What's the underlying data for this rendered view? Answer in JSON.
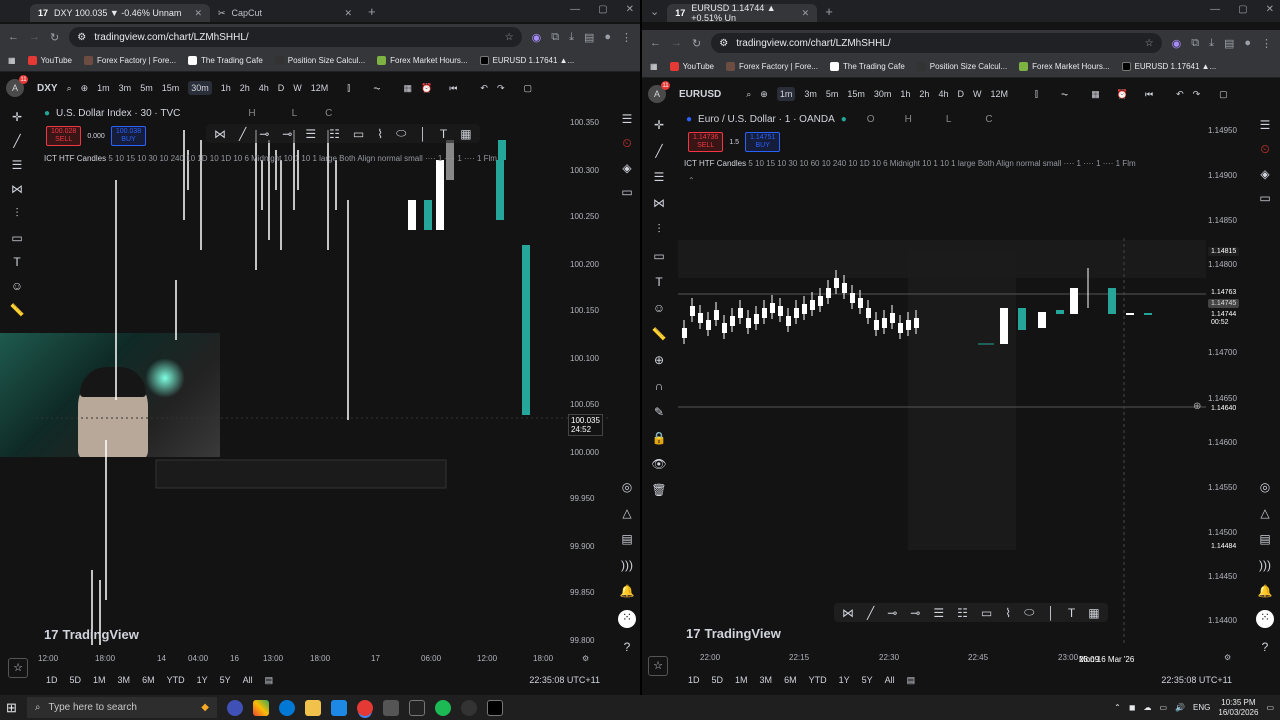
{
  "left": {
    "tabs": [
      {
        "label": "DXY 100.035 ▼ -0.46% Unnam",
        "active": true
      },
      {
        "label": "CapCut",
        "active": false
      }
    ],
    "url": "tradingview.com/chart/LZMhSHHL/",
    "bookmarks": [
      "YouTube",
      "Forex Factory | Fore...",
      "The Trading Cafe",
      "Position Size Calcul...",
      "Forex Market Hours...",
      "EURUSD 1.17641 ▲..."
    ],
    "symbol": "DXY",
    "timeframes": [
      "1m",
      "3m",
      "5m",
      "15m",
      "30m",
      "1h",
      "2h",
      "4h",
      "D",
      "W",
      "12M"
    ],
    "active_tf": "30m",
    "badge_count": "11",
    "title": "U.S. Dollar Index · 30 · TVC",
    "ohlc_h": "H",
    "ohlc_l": "L",
    "ohlc_c": "C",
    "sell_price": "100.028",
    "sell_label": "SELL",
    "spread": "0.000",
    "buy_price": "100.038",
    "buy_label": "BUY",
    "indicator": "ICT HTF Candles",
    "indicator_params": "5 10 15 10 30 10 240 10 1D 10 1D 10 6 Midnight 10 1 10 1 large Both Align normal small ···· 1 ···· 1 ···· 1 Flm",
    "prices": [
      "100.350",
      "100.300",
      "100.250",
      "100.200",
      "100.150",
      "100.100",
      "100.050",
      "100.000",
      "99.950",
      "99.900",
      "99.850",
      "99.800"
    ],
    "last_price": "100.035",
    "countdown": "24:52",
    "times": [
      "12:00",
      "18:00",
      "14",
      "04:00",
      "16",
      "13:00",
      "18:00",
      "17",
      "06:00",
      "12:00",
      "18:00"
    ],
    "ranges": [
      "1D",
      "5D",
      "1M",
      "3M",
      "6M",
      "YTD",
      "1Y",
      "5Y",
      "All"
    ],
    "clock": "22:35:08 UTC+11",
    "brand": "TradingView"
  },
  "right": {
    "tabs": [
      {
        "label": "EURUSD 1.14744 ▲ +0.51% Un",
        "active": true
      }
    ],
    "url": "tradingview.com/chart/LZMhSHHL/",
    "bookmarks": [
      "YouTube",
      "Forex Factory | Fore...",
      "The Trading Cafe",
      "Position Size Calcul...",
      "Forex Market Hours...",
      "EURUSD 1.17641 ▲..."
    ],
    "symbol": "EURUSD",
    "timeframes": [
      "1m",
      "3m",
      "5m",
      "15m",
      "30m",
      "1h",
      "2h",
      "4h",
      "D",
      "W",
      "12M"
    ],
    "active_tf": "1m",
    "badge_count": "11",
    "title": "Euro / U.S. Dollar · 1 · OANDA",
    "ohlc_o": "O",
    "ohlc_h": "H",
    "ohlc_l": "L",
    "ohlc_c": "C",
    "sell_price": "1.14736",
    "sell_label": "SELL",
    "spread": "1.5",
    "buy_price": "1.14751",
    "buy_label": "BUY",
    "indicator": "ICT HTF Candles",
    "indicator_params": "5 10 15 10 30 10 60 10 240 10 1D 10 6 Midnight 10 1 10 1 large Both Align normal small ···· 1 ···· 1 ···· 1 Flm",
    "prices": [
      "1.14950",
      "1.14900",
      "1.14850",
      "1.14800",
      "1.14700",
      "1.14650",
      "1.14600",
      "1.14550",
      "1.14500",
      "1.14450",
      "1.14400"
    ],
    "label_high": "1.14815",
    "label_763": "1.14763",
    "label_745": "1.14745",
    "label_744": "1.14744",
    "countdown": "00:52",
    "label_640": "1.14640",
    "label_484": "1.14484",
    "times": [
      "22:00",
      "22:15",
      "22:30",
      "22:45",
      "23:00"
    ],
    "crosshair_time": "Mon 16 Mar '26",
    "crosshair_time2": "23:09",
    "ranges": [
      "1D",
      "5D",
      "1M",
      "3M",
      "6M",
      "YTD",
      "1Y",
      "5Y",
      "All"
    ],
    "clock": "22:35:08 UTC+11",
    "brand": "TradingView"
  },
  "taskbar": {
    "search_placeholder": "Type here to search",
    "lang": "ENG",
    "time": "10:35 PM",
    "date": "16/03/2026"
  },
  "colors": {
    "up": "#26a69a",
    "down": "#ffffff",
    "bg": "#131313",
    "accent": "#2962ff"
  }
}
